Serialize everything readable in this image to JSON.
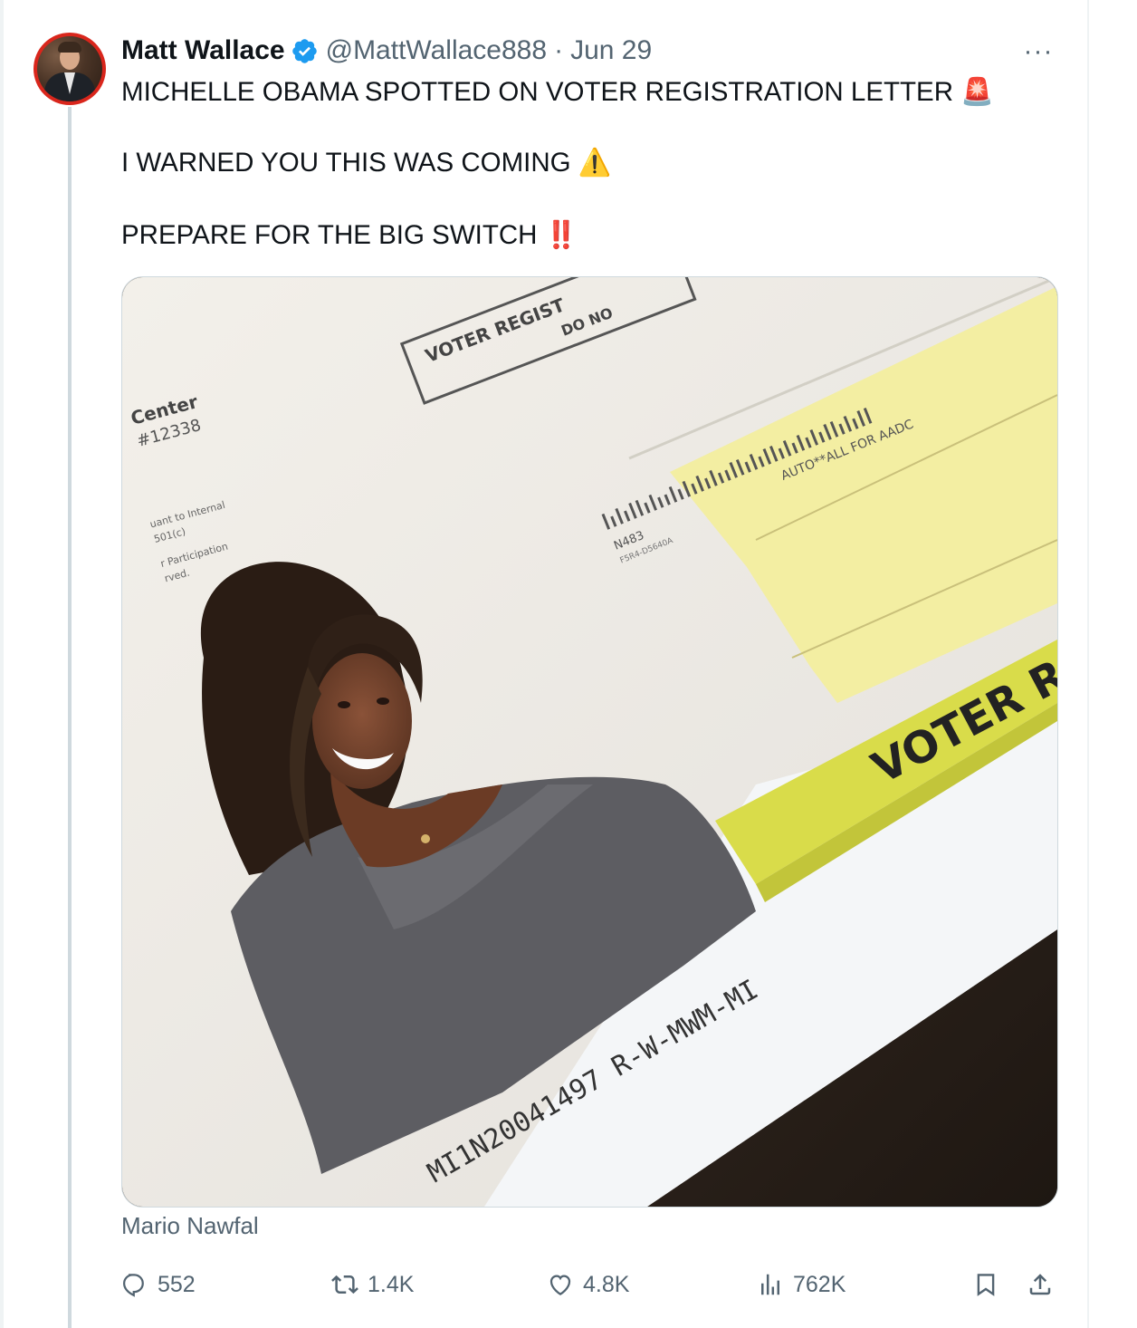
{
  "tweet": {
    "author_name": "Matt Wallace",
    "handle": "@MattWallace888",
    "separator": "·",
    "date": "Jun 29",
    "more_label": "···",
    "text_line_1": "MICHELLE OBAMA SPOTTED ON VOTER REGISTRATION LETTER",
    "text_line_2": "I WARNED YOU THIS WAS COMING",
    "text_line_3": "PREPARE FOR THE BIG SWITCH",
    "emoji_1": "🚨",
    "emoji_2": "⚠️",
    "emoji_3": "‼️",
    "media_attribution": "Mario Nawfal"
  },
  "media": {
    "envelope_box_text_1": "VOTER REGIST",
    "envelope_box_text_2": "DO NO",
    "return_text_1": "Center",
    "return_text_2": "#12338",
    "return_small_1": "uant to Internal",
    "return_small_2": "501(c)",
    "return_small_3": "r Participation",
    "return_small_4": "rved.",
    "barcode_text": "AUTO**ALL FOR AADC",
    "barcode_code_1": "N483",
    "barcode_code_2": "F5R4-D5640A",
    "voter_label": "VOTER R",
    "serial_number": "MI1N20041497 R-W-MWM-MI"
  },
  "actions": {
    "replies": "552",
    "reposts": "1.4K",
    "likes": "4.8K",
    "views": "762K"
  },
  "colors": {
    "accent_blue": "#1d9bf0",
    "text_primary": "#0f1419",
    "text_secondary": "#536471",
    "border": "#cfd9de"
  }
}
